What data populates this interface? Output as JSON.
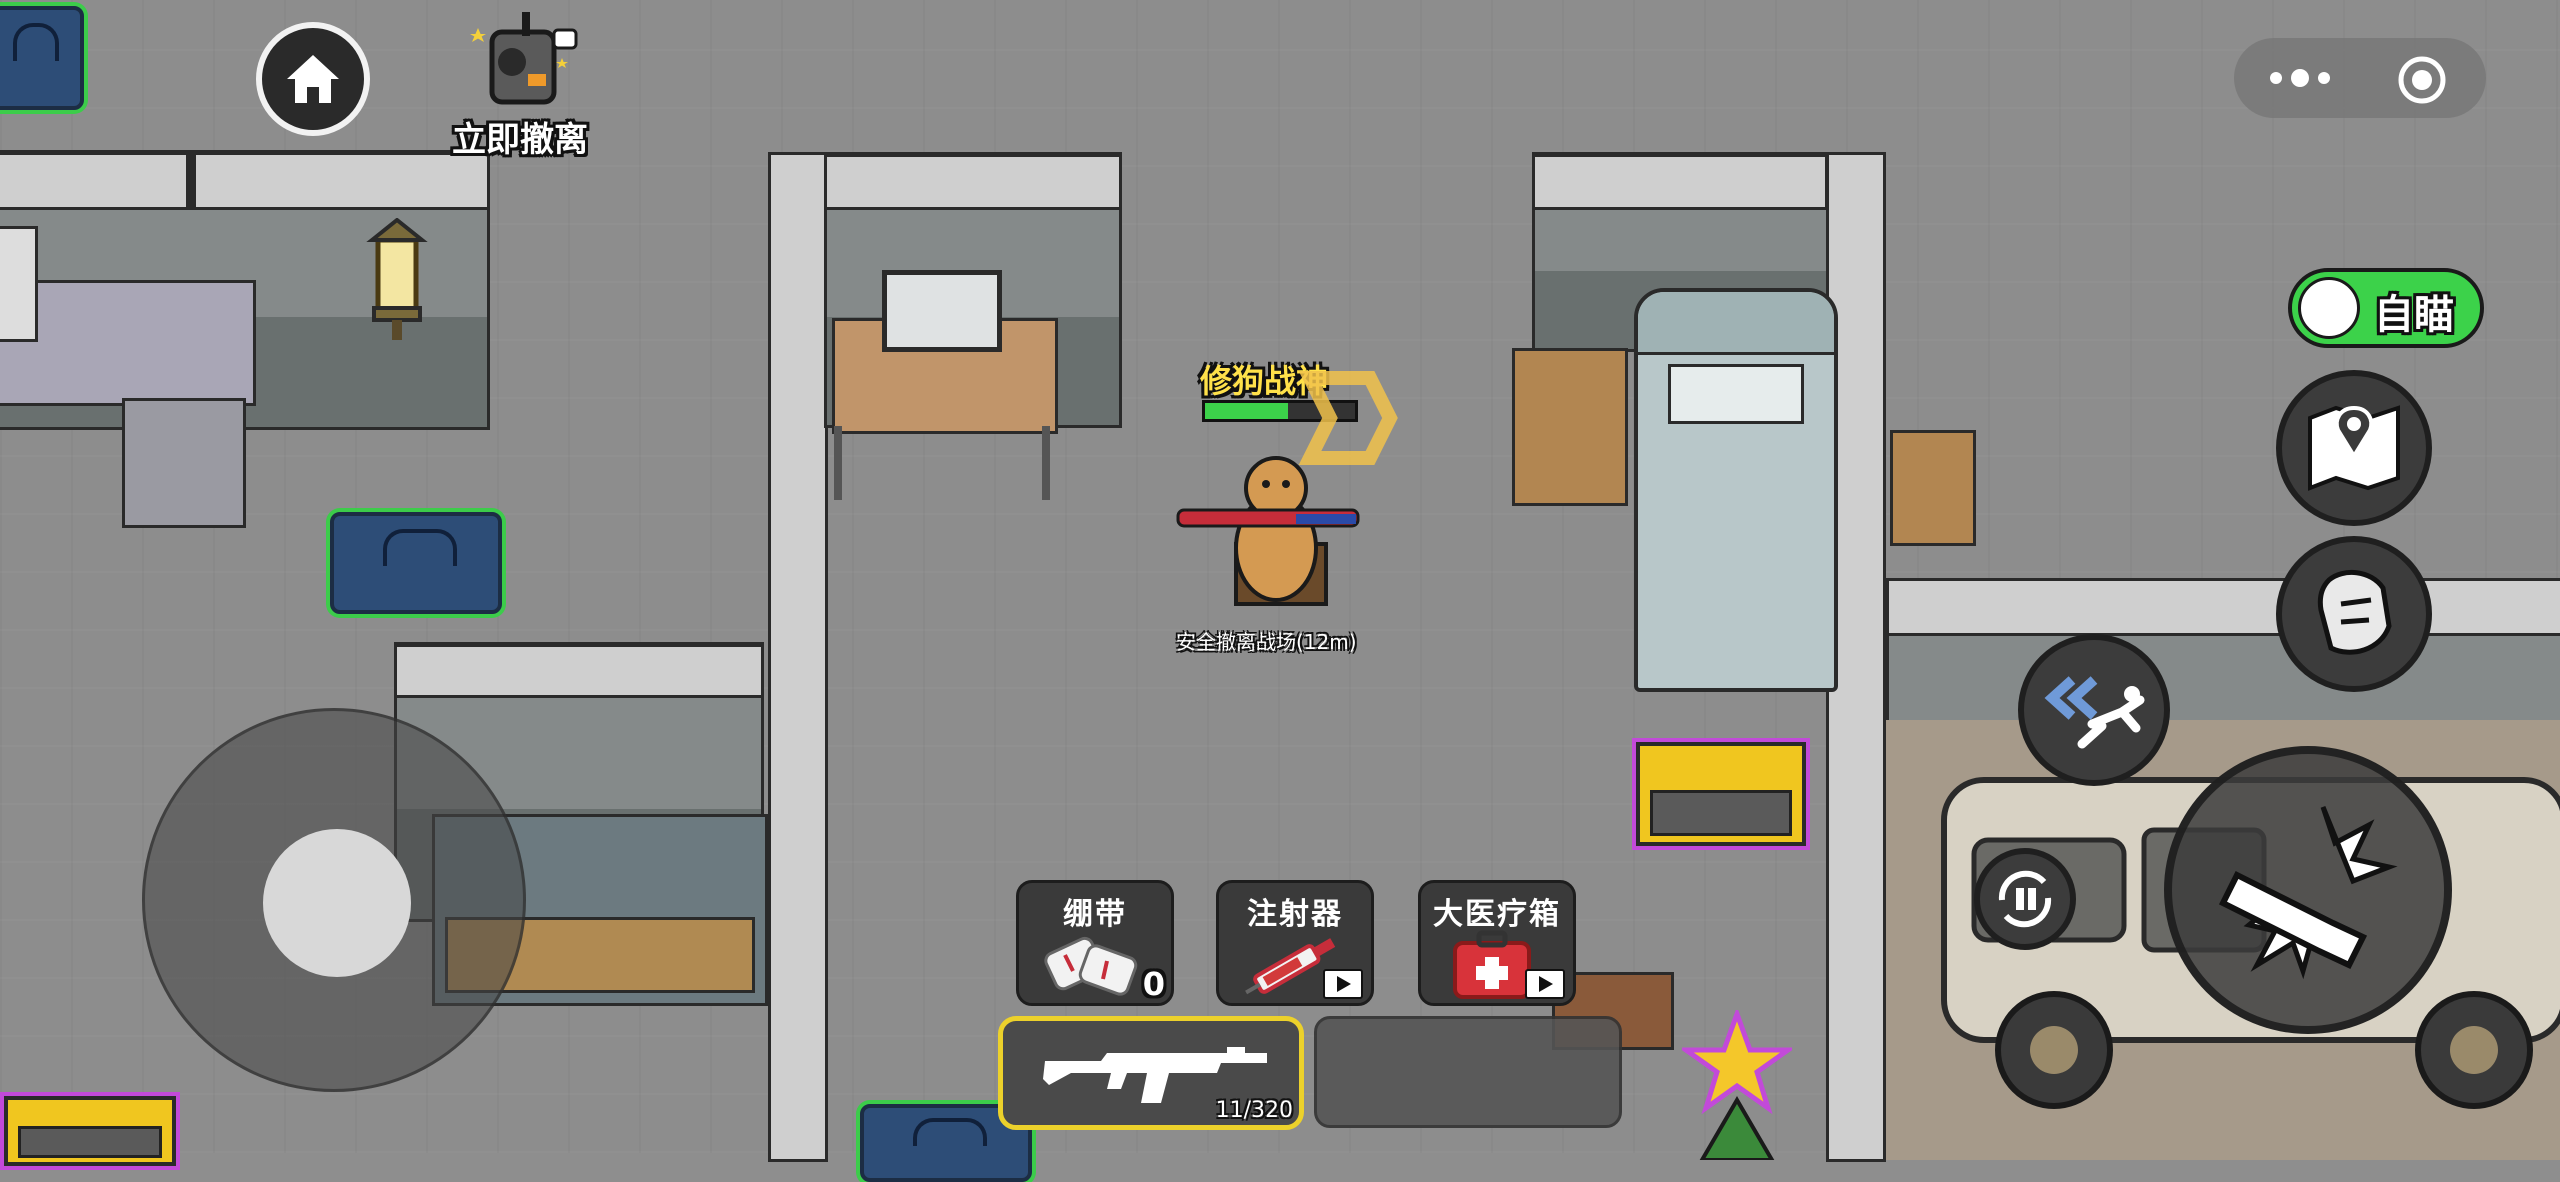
{
  "top_left": {
    "home_icon": "home-icon",
    "evacuate_label": "立即撤离",
    "radio_icon": "radio-device-icon"
  },
  "system_menu": {
    "more_icon": "more-dots-icon",
    "close_icon": "target-circle-icon"
  },
  "player": {
    "name": "修狗战神",
    "health_fraction": 0.55,
    "status_text": "安全撤离战场(12m)",
    "name_color": "#ffe14a",
    "health_color": "#3cd24a"
  },
  "right_controls": {
    "auto_aim_label": "自瞄",
    "auto_aim_enabled": true,
    "map_icon": "map-pin-icon",
    "helmet_icon": "helmet-icon",
    "dash_icon": "dash-icon",
    "reload_icon": "reload-ammo-icon",
    "fire_icon": "fire-bullet-icon"
  },
  "items": [
    {
      "label": "绷带",
      "count": "0",
      "icon": "bandage-icon"
    },
    {
      "label": "注射器",
      "count": "",
      "icon": "syringe-icon",
      "ad": "play-ad-icon"
    },
    {
      "label": "大医疗箱",
      "count": "",
      "icon": "medkit-icon",
      "ad": "play-ad-icon"
    }
  ],
  "weapon": {
    "ammo": "11/320",
    "icon": "rifle-icon"
  },
  "colors": {
    "accent_green": "#3cd24a",
    "slot_highlight": "#ecd12b",
    "loot_outline": "#c24ad9"
  }
}
